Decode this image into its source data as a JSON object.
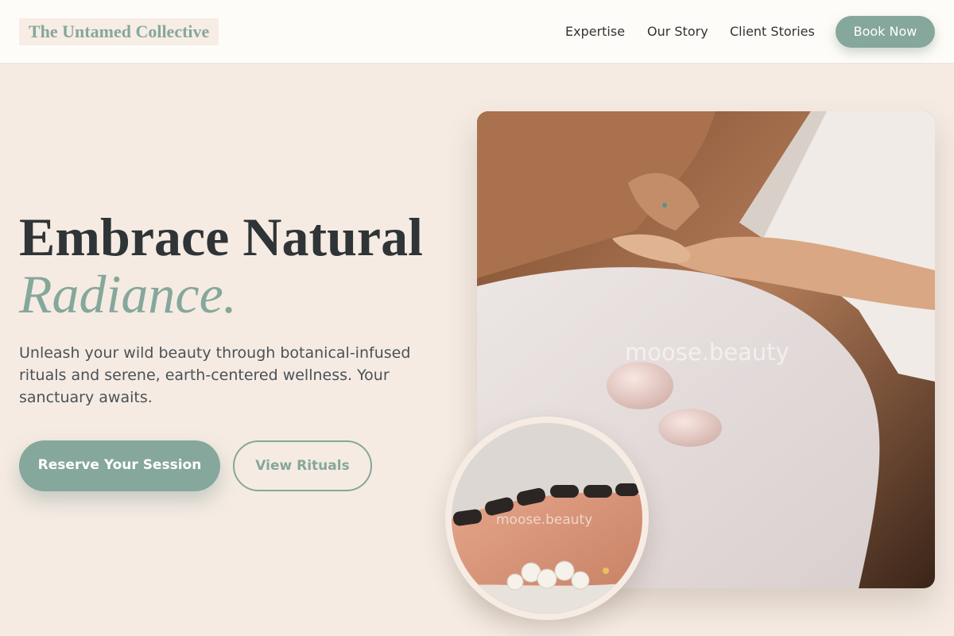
{
  "brand": {
    "name": "The Untamed Collective"
  },
  "nav": {
    "items": [
      {
        "label": "Expertise"
      },
      {
        "label": "Our Story"
      },
      {
        "label": "Client Stories"
      }
    ],
    "cta_label": "Book Now"
  },
  "hero": {
    "title_line1": "Embrace Natural",
    "title_line2": "Radiance.",
    "subtitle": "Unleash your wild beauty through botanical-infused rituals and serene, earth-centered wellness. Your sanctuary awaits.",
    "primary_cta": "Reserve Your Session",
    "secondary_cta": "View Rituals"
  },
  "images": {
    "main_watermark": "moose.beauty",
    "inset_watermark": "moose.beauty"
  },
  "colors": {
    "accent": "#86a79b",
    "background": "#f5ebe3",
    "header_bg": "#fefcf8",
    "text_dark": "#2f3436"
  }
}
